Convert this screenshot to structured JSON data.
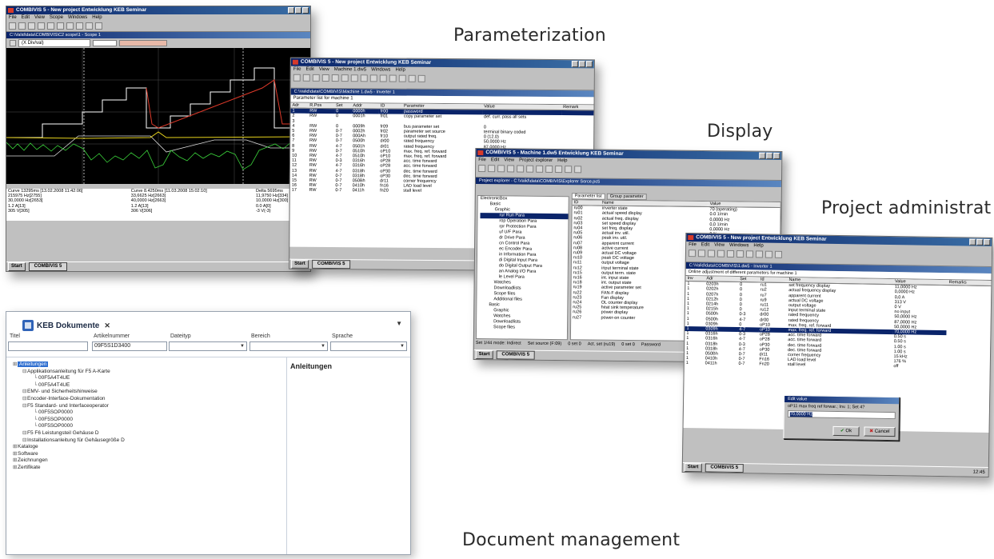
{
  "captions": {
    "parameterization": "Parameterization",
    "display": "Display",
    "project": "Project administrat",
    "document": "Document management"
  },
  "scope_window": {
    "title": "COMBIVIS 5 - New project        Entwicklung KEB Seminar",
    "menu": [
      "File",
      "Edit",
      "View",
      "Scope",
      "Windows",
      "Help"
    ],
    "child_title": "C:\\Valid\\data\\COMBIVIS\\C2 scope\\1 - Scope 1",
    "zoom": "(X Div/val)",
    "readouts": [
      [
        "Curve 13295ms [13.02.2008 11:42:06]",
        "Curve 8.4250ms [11.03.2008 15:02:10]",
        "Delta 5695ms"
      ],
      [
        "215975 Hz[2755]",
        "33,6625 Hz[2663]",
        "11,9750 Hz[334]"
      ],
      [
        "30,0000 Hz[2653]",
        "40,0000 Hz[2663]",
        "10,0000 Hz[300]"
      ],
      [
        "1.2 A[13]",
        "1.2 A[13]",
        "0.0 A[0]"
      ],
      [
        "305 V[305]",
        "306 V[306]",
        "-3 V(-3)"
      ]
    ],
    "task": "COMBIVIS 5",
    "start": "Start"
  },
  "param_window": {
    "title": "COMBIVIS 5 - New project        Entwicklung KEB Seminar",
    "menu": [
      "File",
      "Edit",
      "View",
      "Machine 1.dw5",
      "Windows",
      "Help"
    ],
    "child_title": "C:\\Valid\\data\\COMBIVIS\\Machine 1.dw5 - Inverter 1",
    "list_title": "Parameter list for machine 1",
    "columns": [
      "Adr",
      "R.Pos",
      "Set",
      "Addr",
      "ID",
      "Parameter",
      "Value",
      "Remark"
    ],
    "rows": [
      [
        "1",
        "RW",
        "0",
        "0000h",
        "fr00",
        "password",
        "",
        ""
      ],
      [
        "2",
        "RW",
        "0",
        "0001h",
        "fr01",
        "copy parameter set",
        "def. curr. pass all sets",
        ""
      ],
      [
        "3",
        "",
        "",
        "",
        "",
        "",
        "",
        ""
      ],
      [
        "4",
        "RW",
        "0",
        "0009h",
        "fr09",
        "bus parameter set",
        "0",
        ""
      ],
      [
        "5",
        "RW",
        "0-7",
        "0002h",
        "fr02",
        "parameter set source",
        "terminal binary coded",
        ""
      ],
      [
        "6",
        "RW",
        "0-7",
        "000Ah",
        "fr10",
        "output rated freq.",
        "0 (12.0)",
        ""
      ],
      [
        "7",
        "RW",
        "0-7",
        "0500h",
        "dr00",
        "rated frequency",
        "50,0000 Hz",
        ""
      ],
      [
        "8",
        "RW",
        "4-7",
        "0501h",
        "dr01",
        "rated frequency",
        "87,0000 Hz",
        ""
      ],
      [
        "9",
        "RW",
        "0-7",
        "0510h",
        "oP10",
        "max. freq. ref. forward",
        "50,0000 Hz",
        ""
      ],
      [
        "10",
        "RW",
        "4-7",
        "0510h",
        "oP10",
        "max. freq. ref. forward",
        "70,0000 Hz",
        ""
      ],
      [
        "11",
        "RW",
        "0-3",
        "0316h",
        "oP28",
        "acc. time forward",
        "0.50 s",
        ""
      ],
      [
        "12",
        "RW",
        "4-7",
        "0316h",
        "oP28",
        "acc. time forward",
        "0.50 s",
        ""
      ],
      [
        "13",
        "RW",
        "4-7",
        "0318h",
        "oP30",
        "dec. time forward",
        "1.00 s",
        ""
      ],
      [
        "14",
        "RW",
        "0-7",
        "0318h",
        "oP30",
        "dec. time forward",
        "1.00 s",
        ""
      ],
      [
        "15",
        "RW",
        "0-7",
        "050Bh",
        "dr11",
        "corner frequency",
        "15 kHz",
        ""
      ],
      [
        "16",
        "RW",
        "0-7",
        "0410h",
        "fn16",
        "LAD load level",
        "176 %",
        ""
      ],
      [
        "17",
        "RW",
        "0-7",
        "0411h",
        "fn20",
        "stall level",
        "off",
        ""
      ]
    ],
    "task": "COMBIVIS 5",
    "start": "Start"
  },
  "display_window": {
    "title": "COMBIVIS 5 - Machine 1.dw5        Entwicklung KEB Seminar",
    "menu": [
      "File",
      "Edit",
      "View",
      "Project explorer",
      "Help"
    ],
    "child_title": "Project explorer - C:\\Valid\\data\\COMBIVIS\\Explorer Sorce.pc5",
    "tabs": [
      "Parameter list",
      "Group parameter"
    ],
    "tree": [
      "ElectronicBox",
      "Basic",
      "Graphic",
      "rur Run Para",
      "rop Operation Para",
      "rpr Protection Para",
      "uf U/F Para",
      "dr Drive Para",
      "cn Control Para",
      "ec Encoder Para",
      "in Information Para",
      "di Digital Input Para",
      "do Digital Output Para",
      "an Analog I/O Para",
      "le Level Para",
      "Watches",
      "Downloadlists",
      "Scope files",
      "Additional files",
      "Basic",
      "Graphic",
      "Watches",
      "Downloadlists",
      "Scope files"
    ],
    "columns": [
      "ID",
      "Name",
      "Value"
    ],
    "rows": [
      [
        "ru00",
        "inverter state",
        "70 (operating)"
      ],
      [
        "ru01",
        "actual speed display",
        "0.0 1/min"
      ],
      [
        "ru02",
        "actual freq. display",
        "0,0000 Hz"
      ],
      [
        "ru03",
        "set speed display",
        "0,0 1/min"
      ],
      [
        "ru04",
        "set freq. display",
        "0,0000 Hz"
      ],
      [
        "ru05",
        "actual inv. util.",
        "0 %"
      ],
      [
        "ru06",
        "peak inv. util.",
        "0 %"
      ],
      [
        "ru07",
        "apparent current",
        "0,0 A"
      ],
      [
        "ru08",
        "active current",
        "0,0 A"
      ],
      [
        "ru09",
        "actual DC voltage",
        "314 V"
      ],
      [
        "ru10",
        "peak DC voltage",
        "322 V"
      ],
      [
        "ru11",
        "output voltage",
        "0 V"
      ],
      [
        "ru12",
        "input terminal state",
        "0"
      ],
      [
        "ru15",
        "output term. state",
        "2: 12"
      ],
      [
        "ru16",
        "int. input state",
        "5: 13 off"
      ],
      [
        "ru18",
        "int. output state",
        "0"
      ],
      [
        "ru19",
        "active parameter set",
        "0: set 0"
      ],
      [
        "ru22",
        "FAN-F display",
        "0,0 %"
      ],
      [
        "ru23",
        "Fan display",
        "0,0 %"
      ],
      [
        "ru24",
        "OL counter display",
        "0 %"
      ],
      [
        "ru25",
        "heat sink temperature",
        "22"
      ],
      [
        "ru26",
        "power display",
        "0,0 %"
      ],
      [
        "ru27",
        "power-on counter",
        "365 h"
      ]
    ],
    "status": [
      "Set 1/44 mode: Indirect",
      "Set source (F:09)",
      "0 set 0",
      "Act. set (ru19)",
      "0 set 0",
      "Password"
    ],
    "task": "COMBIVIS 5",
    "start": "Start"
  },
  "project_window": {
    "title": "COMBIVIS 5 - New project        Entwicklung KEB Seminar",
    "menu": [
      "File",
      "Edit",
      "View",
      "Windows",
      "Help"
    ],
    "child_title": "C:\\Valid\\data\\COMBIVIS\\1.dw5 - Inverter 1",
    "list_title": "Online adjustment of different parameters for machine 1",
    "columns": [
      "Inv",
      "Adr",
      "Set",
      "Id",
      "Name",
      "Value",
      "Remarks"
    ],
    "rows": [
      [
        "1",
        "0203h",
        "0",
        "ru1",
        "set frequency display",
        "11,0000 Hz"
      ],
      [
        "1",
        "0202h",
        "0",
        "ru2",
        "actual frequency display",
        "0,0000 Hz"
      ],
      [
        "1",
        "0207h",
        "0",
        "ru7",
        "apparent current",
        "0,0 A"
      ],
      [
        "1",
        "0212h",
        "0",
        "ru9",
        "actual DC voltage",
        "313 V"
      ],
      [
        "1",
        "0214h",
        "0",
        "ru11",
        "output voltage",
        "0 V"
      ],
      [
        "1",
        "0215h",
        "0",
        "ru12",
        "input terminal state",
        "no input"
      ],
      [
        "",
        "",
        "",
        "",
        "",
        ""
      ],
      [
        "1",
        "0500h",
        "0-3",
        "dr00",
        "rated frequency",
        "50,0000 Hz"
      ],
      [
        "1",
        "0500h",
        "4-7",
        "dr00",
        "rated frequency",
        "87,0000 Hz"
      ],
      [
        "1",
        "0309h",
        "0",
        "oP10",
        "max. freq. ref. forward",
        "50,0000 Hz"
      ],
      [
        "1",
        "0309h",
        "4-7",
        "oP10",
        "max. freq. ref. forward",
        "70,0000 Hz"
      ],
      [
        "1",
        "0316h",
        "0-3",
        "oP28",
        "acc. time forward",
        "0.50 s"
      ],
      [
        "1",
        "0316h",
        "4-7",
        "oP28",
        "acc. time forward",
        "0.50 s"
      ],
      [
        "1",
        "0318h",
        "0-3",
        "oP30",
        "dec. time forward",
        "1.00 s"
      ],
      [
        "1",
        "0318h",
        "4-7",
        "oP30",
        "dec. time forward",
        "1.00 s"
      ],
      [
        "1",
        "050Bh",
        "0-7",
        "dr11",
        "corner frequency",
        "15 kHz"
      ],
      [
        "1",
        "0410h",
        "0-7",
        "Fn16",
        "LAD load level",
        "176 %"
      ],
      [
        "1",
        "0411h",
        "0-7",
        "Fn20",
        "stall level",
        "off"
      ]
    ],
    "dialog_title": "Edit value",
    "dialog_prompt": "oP11 max freq ref forwar.; Inv. 1; Set 4?",
    "dialog_value": "70,0000 Hz",
    "ok": "Ok",
    "cancel": "Cancel",
    "task": "COMBIVIS 5",
    "start": "Start",
    "clock": "12:45"
  },
  "doc_window": {
    "tab_label": "KEB Dokumente",
    "filter_labels": [
      "Titel",
      "Artikelnummer",
      "Dateityp",
      "Bereich",
      "Sprache"
    ],
    "filter_values": [
      "",
      "09F5S1D3400",
      "",
      "",
      ""
    ],
    "tree": [
      {
        "text": "Anleitungen",
        "level": 0,
        "highlight": true
      },
      {
        "text": "Applikationsanleitung für F5 A-Karte",
        "level": 1
      },
      {
        "text": "00F5A4T4UE",
        "level": 2
      },
      {
        "text": "00F5A4T4UE",
        "level": 2
      },
      {
        "text": "EMV- und Sicherheitshinweise",
        "level": 1
      },
      {
        "text": "Encoder-Interface-Dokumentation",
        "level": 1
      },
      {
        "text": "F5 Standard- und Interfaceoperator",
        "level": 1
      },
      {
        "text": "00F5SOP0000",
        "level": 2
      },
      {
        "text": "00F5SOP0000",
        "level": 2
      },
      {
        "text": "00F5SOP0000",
        "level": 2
      },
      {
        "text": "F5 F6 Leistungsteil Gehäuse D",
        "level": 1
      },
      {
        "text": "Installationsanleitung für Gehäusegröße D",
        "level": 1
      },
      {
        "text": "Kataloge",
        "level": 0
      },
      {
        "text": "Software",
        "level": 0
      },
      {
        "text": "Zeichnungen",
        "level": 0
      },
      {
        "text": "Zertifikate",
        "level": 0
      }
    ],
    "panel_title": "Anleitungen"
  },
  "colors": {
    "title_blue": "#0a246a",
    "scope_bg": "#000000",
    "trace_white": "#ffffff",
    "trace_yellow": "#e6d21c",
    "trace_green": "#3bd23b",
    "trace_red": "#e03a2a"
  }
}
